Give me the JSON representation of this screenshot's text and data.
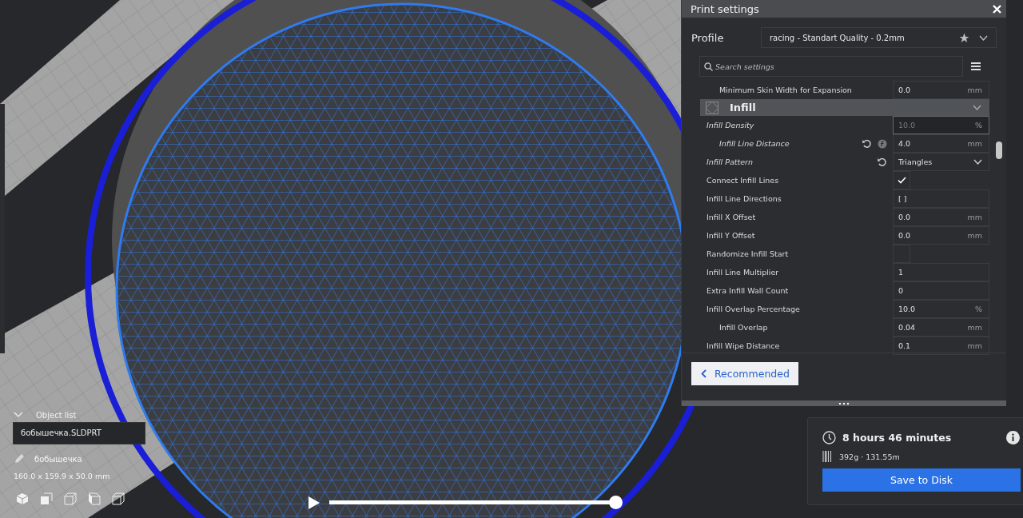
{
  "viewport": {
    "object_list": {
      "label": "Object list",
      "expanded": true,
      "items": [
        {
          "name": "бобышечка.SLDPRT",
          "selected": true
        }
      ]
    },
    "object_name": "бобышечка",
    "dimensions": "160.0 x 159.9 x 50.0 mm"
  },
  "playback": {
    "level": 1
  },
  "print_settings": {
    "title": "Print settings",
    "profile_label": "Profile",
    "profile_value": "racing - Standart Quality - 0.2mm",
    "search_placeholder": "Search settings",
    "settings": [
      {
        "kind": "group",
        "children": [
          {
            "kind": "field",
            "label": "Minimum Skin Width for Expansion",
            "value": "0.0",
            "unit": "mm",
            "modified": false,
            "focused": false
          }
        ]
      },
      {
        "kind": "category",
        "label": "Infill",
        "expanded": true,
        "children": [
          {
            "kind": "field",
            "label": "Infill Density",
            "value": "10.0",
            "unit": "%",
            "modified": true,
            "focused": true,
            "children": [
              {
                "kind": "field",
                "label": "Infill Line Distance",
                "value": "4.0",
                "unit": "mm",
                "modified": true,
                "focused": false,
                "actions": [
                  {
                    "kind": "reset"
                  },
                  {
                    "kind": "formula"
                  }
                ]
              }
            ]
          },
          {
            "kind": "dropdown",
            "label": "Infill Pattern",
            "value": "Triangles",
            "modified": true,
            "actions": [
              {
                "kind": "reset"
              }
            ]
          },
          {
            "kind": "checkbox",
            "label": "Connect Infill Lines",
            "checked": true,
            "modified": false
          },
          {
            "kind": "field",
            "label": "Infill Line Directions",
            "value": "[ ]",
            "modified": false,
            "focused": false
          },
          {
            "kind": "field",
            "label": "Infill X Offset",
            "value": "0.0",
            "unit": "mm",
            "modified": false,
            "focused": false
          },
          {
            "kind": "field",
            "label": "Infill Y Offset",
            "value": "0.0",
            "unit": "mm",
            "modified": false,
            "focused": false
          },
          {
            "kind": "checkbox",
            "label": "Randomize Infill Start",
            "checked": false,
            "modified": false
          },
          {
            "kind": "field",
            "label": "Infill Line Multiplier",
            "value": "1",
            "modified": false,
            "focused": false
          },
          {
            "kind": "field",
            "label": "Extra Infill Wall Count",
            "value": "0",
            "modified": false,
            "focused": false
          },
          {
            "kind": "field",
            "label": "Infill Overlap Percentage",
            "value": "10.0",
            "unit": "%",
            "modified": false,
            "focused": false,
            "children": [
              {
                "kind": "field",
                "label": "Infill Overlap",
                "value": "0.04",
                "unit": "mm",
                "modified": false,
                "focused": false
              }
            ]
          },
          {
            "kind": "field",
            "label": "Infill Wipe Distance",
            "value": "0.1",
            "unit": "mm",
            "modified": false,
            "focused": false
          }
        ]
      }
    ],
    "recommended_button": "Recommended"
  },
  "estimate": {
    "time": "8 hours 46 minutes",
    "material": "392g · 131.55m",
    "save_button": "Save to Disk"
  }
}
